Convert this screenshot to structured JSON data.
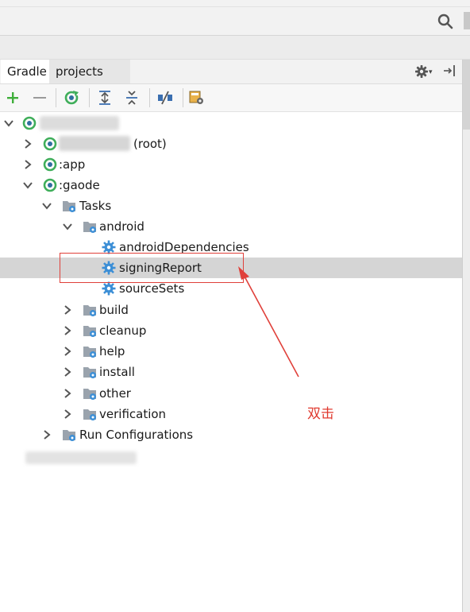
{
  "window": {
    "tabs": [
      {
        "label": "Gradle",
        "active": true
      },
      {
        "label": "projects",
        "active": false
      }
    ]
  },
  "toolbar": {
    "buttons": [
      "add-icon",
      "remove-icon",
      "refresh-icon",
      "expand-all-icon",
      "collapse-all-icon",
      "toggle-offline-icon",
      "settings-tool-icon"
    ]
  },
  "tree": {
    "root_suffix": "(root)",
    "app": ":app",
    "gaode": ":gaode",
    "tasks": "Tasks",
    "android": "android",
    "android_items": [
      "androidDependencies",
      "signingReport",
      "sourceSets"
    ],
    "groups": [
      "build",
      "cleanup",
      "help",
      "install",
      "other",
      "verification"
    ],
    "run_configurations": "Run Configurations",
    "selected": "signingReport"
  },
  "annotation": {
    "text": "双击",
    "color": "#e03a2f"
  },
  "colors": {
    "gradle_green": "#3fae5a",
    "folder_gray": "#9aa3ad",
    "task_blue": "#3d8fd6",
    "selection": "#d5d5d5"
  }
}
